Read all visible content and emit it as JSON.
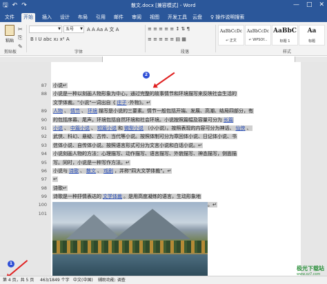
{
  "titlebar": {
    "title": "散文.docx [兼容模式] - Word",
    "qat": {
      "save_icon": "save-icon",
      "undo_icon": "undo-icon",
      "redo_icon": "redo-icon"
    },
    "controls": {
      "minimize": "—",
      "maximize": "□",
      "close": "✕"
    }
  },
  "tabs": [
    {
      "label": "文件"
    },
    {
      "label": "开始"
    },
    {
      "label": "插入"
    },
    {
      "label": "设计"
    },
    {
      "label": "布局"
    },
    {
      "label": "引用"
    },
    {
      "label": "邮件"
    },
    {
      "label": "审阅"
    },
    {
      "label": "视图"
    },
    {
      "label": "开发工具"
    },
    {
      "label": "云盘"
    },
    {
      "label": "♀ 操作说明搜索"
    }
  ],
  "ribbon": {
    "paste_label": "粘贴",
    "clipboard_group": "剪贴板",
    "font_group": "字体",
    "paragraph_group": "段落",
    "styles_group": "样式",
    "font_name": "",
    "font_size": "五号",
    "format_row1": "A  A  Aa  A  文  A",
    "format_row2": "B  I  U  abc  x₂  x²  A",
    "para_row1": "≡  ≡  ≡  ≡  ≡  ↕  ⇅  ¶",
    "para_row2": "≡  ≡  ≡  ≡  ≡  ▤  ▦",
    "styles": [
      {
        "sample": "AaBbCcDc",
        "name": "↵ 正文"
      },
      {
        "sample": "AaBbCcDc",
        "name": "↵ WPSOf..."
      },
      {
        "sample": "AaBbC",
        "name": "标题 1"
      },
      {
        "sample": "Aa",
        "name": "标题"
      }
    ]
  },
  "document": {
    "lines": [
      {
        "num": "87",
        "parts": [
          {
            "t": "小说↵"
          }
        ]
      },
      {
        "num": "88",
        "parts": [
          {
            "t": "小说是一种以刻画人物形象为中心，通过完整的故事情节和环境描写来反映社会生活的"
          }
        ]
      },
      {
        "num": "",
        "parts": [
          {
            "t": "文学体裁。\"小说\"一词出自《"
          },
          {
            "t": "庄子",
            "link": true
          },
          {
            "t": "·外物》。↵"
          }
        ]
      },
      {
        "num": "89",
        "parts": [
          {
            "t": "人物",
            "link": true
          },
          {
            "t": "、"
          },
          {
            "t": "情节",
            "link": true
          },
          {
            "t": "、"
          },
          {
            "t": "环境",
            "link": true
          },
          {
            "t": "描写是小说的三要素。情节一般包括开端、发展、高潮、结局四部分，有"
          }
        ]
      },
      {
        "num": "90",
        "parts": [
          {
            "t": "的包括序幕、尾声。环境包括自然环境和社会环境。小说按照篇幅及容量可分为"
          },
          {
            "t": "长篇",
            "link": true
          }
        ]
      },
      {
        "num": "91",
        "parts": [
          {
            "t": "小说",
            "link": true
          },
          {
            "t": "、"
          },
          {
            "t": "中篇小说",
            "link": true
          },
          {
            "t": "、"
          },
          {
            "t": "短篇小说",
            "link": true
          },
          {
            "t": "和"
          },
          {
            "t": "微型小说",
            "link": true
          },
          {
            "t": "（小小说）。按照表现的内容可分为神话、"
          },
          {
            "t": "仙侠",
            "link": true
          },
          {
            "t": "、"
          }
        ]
      },
      {
        "num": "92",
        "parts": [
          {
            "t": "武侠、科幻、悬疑、古传、当代等小说。按照体制可分为章回体小说、日记体小说、书"
          }
        ]
      },
      {
        "num": "93",
        "parts": [
          {
            "t": "信体小说、自传体小说。按照语言形式可分为文言小说和白话小说。↵"
          }
        ]
      },
      {
        "num": "94",
        "parts": [
          {
            "t": "小说刻画人物的方法：心理描写、动作描写、语言描写、外貌描写、神态描写，侧面描"
          }
        ]
      },
      {
        "num": "95",
        "parts": [
          {
            "t": "写。同时，小说是一种写作方法。↵"
          }
        ]
      },
      {
        "num": "96",
        "parts": [
          {
            "t": "小说与"
          },
          {
            "t": "诗歌",
            "link": true
          },
          {
            "t": "、"
          },
          {
            "t": "散文",
            "link": true
          },
          {
            "t": "、"
          },
          {
            "t": "戏剧",
            "link": true
          },
          {
            "t": "，并称\"四大文学体裁\"。↵"
          }
        ]
      },
      {
        "num": "97",
        "parts": [
          {
            "t": "↵"
          }
        ]
      },
      {
        "num": "98",
        "parts": [
          {
            "t": "诗歌↵"
          }
        ]
      },
      {
        "num": "99",
        "parts": [
          {
            "t": "诗歌是一种抒情表达的"
          },
          {
            "t": "文学体裁",
            "link": true
          },
          {
            "t": "。是用高度凝练的语言，生动形象地"
          }
        ]
      },
      {
        "num": "100",
        "parts": [
          {
            "t": "表达作者丰富情感，集中反映社会生活并具有一定节奏和韵律的文学体裁。↵"
          }
        ]
      },
      {
        "num": "101",
        "parts": [
          {
            "t": ""
          }
        ]
      }
    ]
  },
  "annotations": {
    "marker1": "1",
    "marker2": "2"
  },
  "status": {
    "page": "第 4 页，共 5 页",
    "words": "463/1849 个字",
    "lang": "中文(中国)",
    "accessibility": "辅助功能: 调查"
  },
  "watermark": {
    "brand": "极光下载站",
    "url": "www.xz7.com"
  }
}
